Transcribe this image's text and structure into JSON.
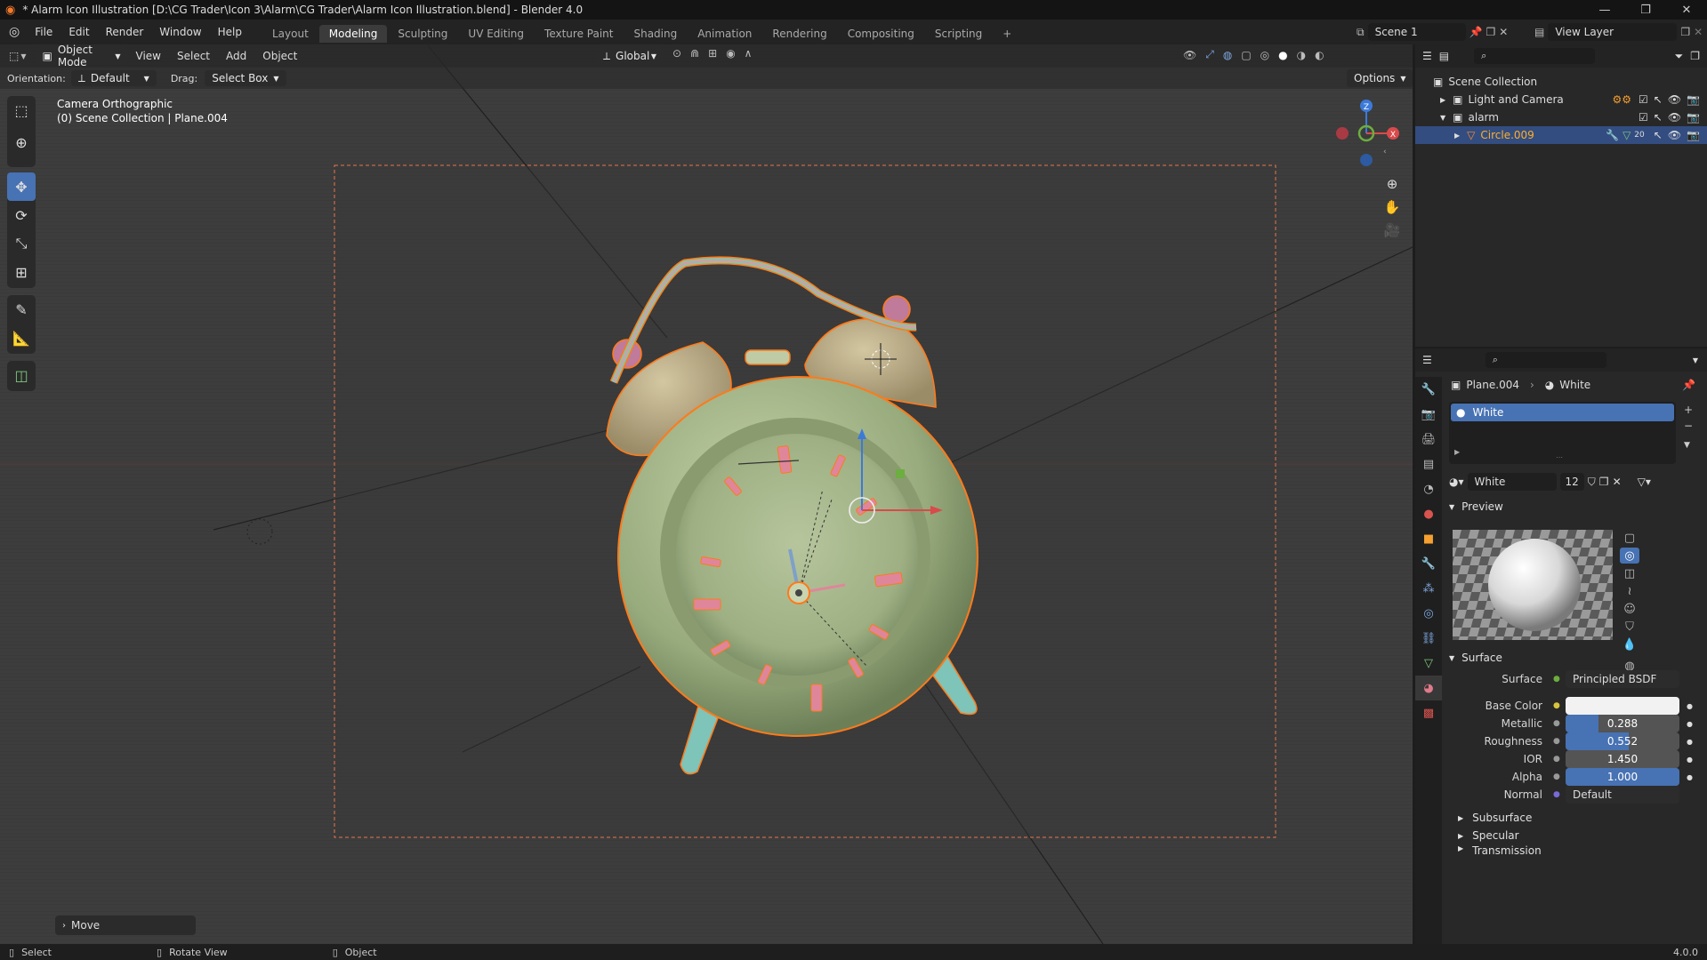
{
  "titlebar": {
    "title": "* Alarm Icon Illustration [D:\\CG Trader\\Icon 3\\Alarm\\CG Trader\\Alarm Icon Illustration.blend] - Blender 4.0"
  },
  "menubar": {
    "menus": [
      "File",
      "Edit",
      "Render",
      "Window",
      "Help"
    ],
    "workspaces": [
      "Layout",
      "Modeling",
      "Sculpting",
      "UV Editing",
      "Texture Paint",
      "Shading",
      "Animation",
      "Rendering",
      "Compositing",
      "Scripting"
    ],
    "active_workspace": "Modeling",
    "add_workspace": "+",
    "scene": "Scene 1",
    "view_layer": "View Layer"
  },
  "viewport_header": {
    "mode": "Object Mode",
    "menus": [
      "View",
      "Select",
      "Add",
      "Object"
    ],
    "transform": "Global",
    "options": "Options"
  },
  "tool_header": {
    "orientation_label": "Orientation:",
    "orientation_value": "Default",
    "drag_label": "Drag:",
    "drag_value": "Select Box"
  },
  "viewport": {
    "camera_label": "Camera Orthographic",
    "collection_label": "(0) Scene Collection | Plane.004",
    "last_op": "Move",
    "gizmo_axes": [
      "Z",
      "X"
    ]
  },
  "outliner": {
    "root": "Scene Collection",
    "items": [
      {
        "label": "Light and Camera",
        "level": 1,
        "expanded": false
      },
      {
        "label": "alarm",
        "level": 1,
        "expanded": true
      },
      {
        "label": "Circle.009",
        "level": 2,
        "expanded": false,
        "selected": true
      }
    ],
    "modifier_count": "20"
  },
  "properties": {
    "breadcrumb_object": "Plane.004",
    "breadcrumb_material": "White",
    "slot_name": "White",
    "material_name": "White",
    "user_count": "12",
    "preview_label": "Preview",
    "surface_panel_label": "Surface",
    "surface_field_label": "Surface",
    "surface_shader": "Principled BSDF",
    "base_color_label": "Base Color",
    "base_color": "#f2f2f2",
    "metallic_label": "Metallic",
    "metallic": 0.288,
    "metallic_text": "0.288",
    "roughness_label": "Roughness",
    "roughness": 0.552,
    "roughness_text": "0.552",
    "ior_label": "IOR",
    "ior_text": "1.450",
    "alpha_label": "Alpha",
    "alpha": 1.0,
    "alpha_text": "1.000",
    "normal_label": "Normal",
    "normal_value": "Default",
    "subsurface_label": "Subsurface",
    "specular_label": "Specular",
    "transmission_label": "Transmission"
  },
  "statusbar": {
    "select": "Select",
    "rotate": "Rotate View",
    "object": "Object",
    "version": "4.0.0"
  },
  "colors": {
    "accent": "#4772b3",
    "selection_orange": "#ff7a1a",
    "clock_green": "#a7b88a",
    "bell_tan": "#b9ab88",
    "teal_feet": "#7ec4b8",
    "pink_marks": "#e0869a"
  }
}
